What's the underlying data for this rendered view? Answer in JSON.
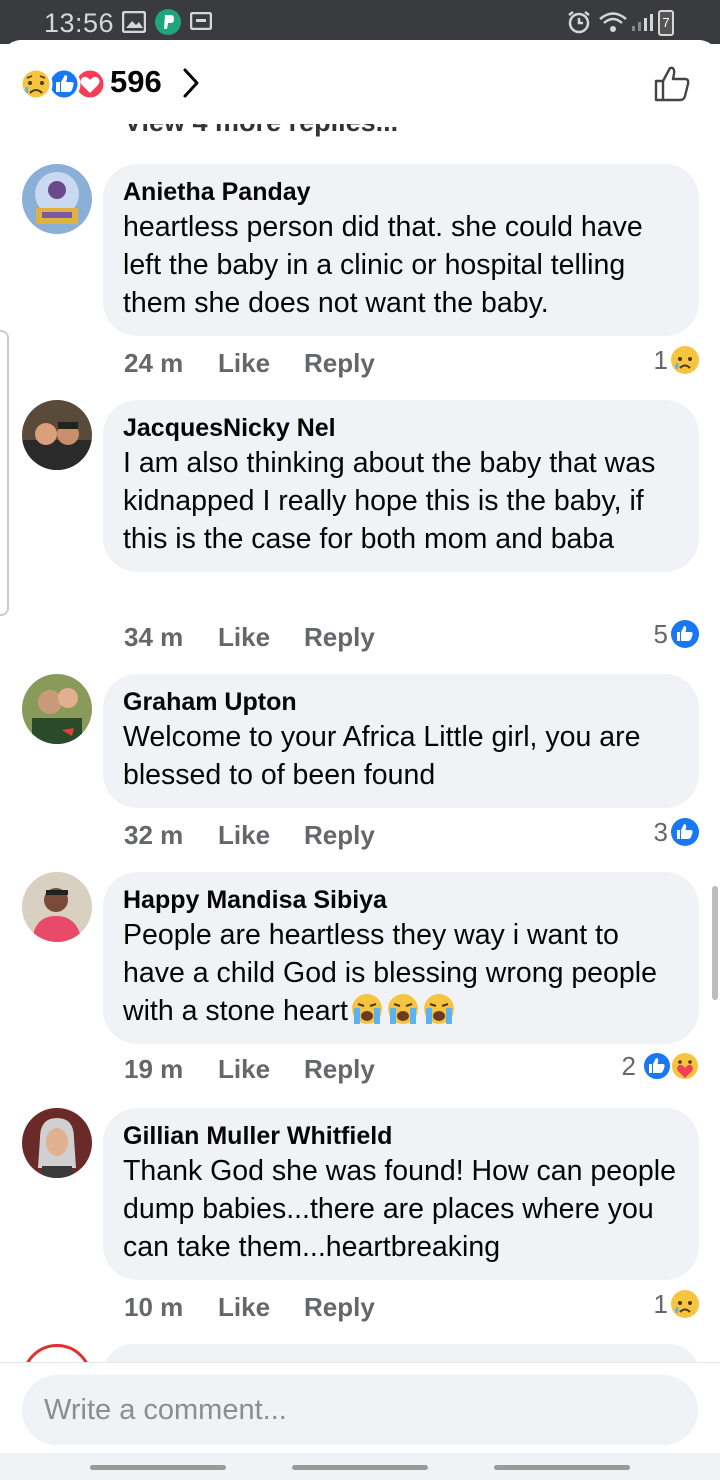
{
  "status_bar": {
    "time": "13:56",
    "battery": "7"
  },
  "header": {
    "reaction_count": "596",
    "icons": [
      "sad-icon",
      "like-icon",
      "love-icon",
      "chevron-right-icon",
      "thumbs-up-outline-icon"
    ]
  },
  "view_more": "View 4 more replies...",
  "comments": [
    {
      "author": "Anietha Panday",
      "text": "heartless person did that. she could have left the baby in a clinic or hospital telling them she does not want the baby.",
      "time": "24 m",
      "like": "Like",
      "reply": "Reply",
      "reaction_count": "1",
      "reactions": [
        "sad"
      ]
    },
    {
      "author": "JacquesNicky Nel",
      "text": "I am also thinking about the baby that was kidnapped I really hope this is the baby, if this is the case for both mom and baba",
      "time": "34 m",
      "like": "Like",
      "reply": "Reply",
      "reaction_count": "5",
      "reactions": [
        "like"
      ]
    },
    {
      "author": "Graham Upton",
      "text": "Welcome to your Africa Little girl, you are blessed to of been found",
      "time": "32 m",
      "like": "Like",
      "reply": "Reply",
      "reaction_count": "3",
      "reactions": [
        "like"
      ]
    },
    {
      "author": "Happy Mandisa Sibiya",
      "text": "People are heartless they way i want to have a child God is blessing wrong people with a stone heart",
      "time": "19 m",
      "like": "Like",
      "reply": "Reply",
      "reaction_count": "2",
      "reactions": [
        "like",
        "care"
      ]
    },
    {
      "author": "Gillian Muller Whitfield",
      "text": "Thank God she was found! How can people dump babies...there are places where you can take them...heartbreaking",
      "time": "10 m",
      "like": "Like",
      "reply": "Reply",
      "reaction_count": "1",
      "reactions": [
        "sad"
      ]
    }
  ],
  "composer": {
    "placeholder": "Write a comment..."
  },
  "colors": {
    "bubble": "#f0f2f5",
    "meta": "#65676b",
    "like_blue": "#1877f2",
    "love_red": "#f33e58",
    "sad_yellow": "#f7c43f"
  }
}
